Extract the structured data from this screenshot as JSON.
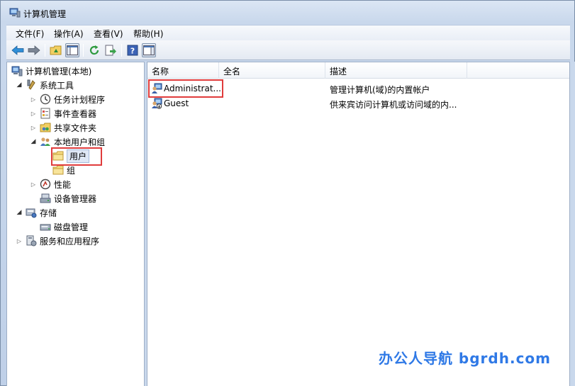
{
  "window": {
    "title": "计算机管理"
  },
  "menu": [
    "文件(F)",
    "操作(A)",
    "查看(V)",
    "帮助(H)"
  ],
  "toolbar": {
    "buttons": [
      "back-icon",
      "forward-icon",
      "up-folder-icon",
      "show-hide-tree-icon",
      "refresh-icon",
      "export-list-icon",
      "help-icon",
      "show-hide-action-pane-icon"
    ]
  },
  "tree": [
    {
      "label": "计算机管理(本地)",
      "icon": "computer-management-icon",
      "level": 0,
      "expander": ""
    },
    {
      "label": "系统工具",
      "icon": "system-tools-icon",
      "level": 1,
      "expander": "open"
    },
    {
      "label": "任务计划程序",
      "icon": "task-scheduler-icon",
      "level": 2,
      "expander": "closed"
    },
    {
      "label": "事件查看器",
      "icon": "event-viewer-icon",
      "level": 2,
      "expander": "closed"
    },
    {
      "label": "共享文件夹",
      "icon": "shared-folders-icon",
      "level": 2,
      "expander": "closed"
    },
    {
      "label": "本地用户和组",
      "icon": "local-users-groups-icon",
      "level": 2,
      "expander": "open"
    },
    {
      "label": "用户",
      "icon": "folder-icon",
      "level": 3,
      "expander": "",
      "selected": true
    },
    {
      "label": "组",
      "icon": "folder-icon",
      "level": 3,
      "expander": ""
    },
    {
      "label": "性能",
      "icon": "performance-icon",
      "level": 2,
      "expander": "closed"
    },
    {
      "label": "设备管理器",
      "icon": "device-manager-icon",
      "level": 2,
      "expander": ""
    },
    {
      "label": "存储",
      "icon": "storage-icon",
      "level": 1,
      "expander": "open"
    },
    {
      "label": "磁盘管理",
      "icon": "disk-management-icon",
      "level": 2,
      "expander": ""
    },
    {
      "label": "服务和应用程序",
      "icon": "services-apps-icon",
      "level": 1,
      "expander": "closed"
    }
  ],
  "list": {
    "columns": [
      "名称",
      "全名",
      "描述"
    ],
    "rows": [
      {
        "name": "Administrat...",
        "fullname": "",
        "description": "管理计算机(域)的内置帐户",
        "icon": "user-icon"
      },
      {
        "name": "Guest",
        "fullname": "",
        "description": "供来宾访问计算机或访问域的内...",
        "icon": "user-disabled-icon"
      }
    ]
  },
  "watermark": "办公人导航  bgrdh.com",
  "colors": {
    "highlight": "#e03c3c",
    "watermark": "#2f79e6",
    "selection": "#dfe8f6"
  }
}
